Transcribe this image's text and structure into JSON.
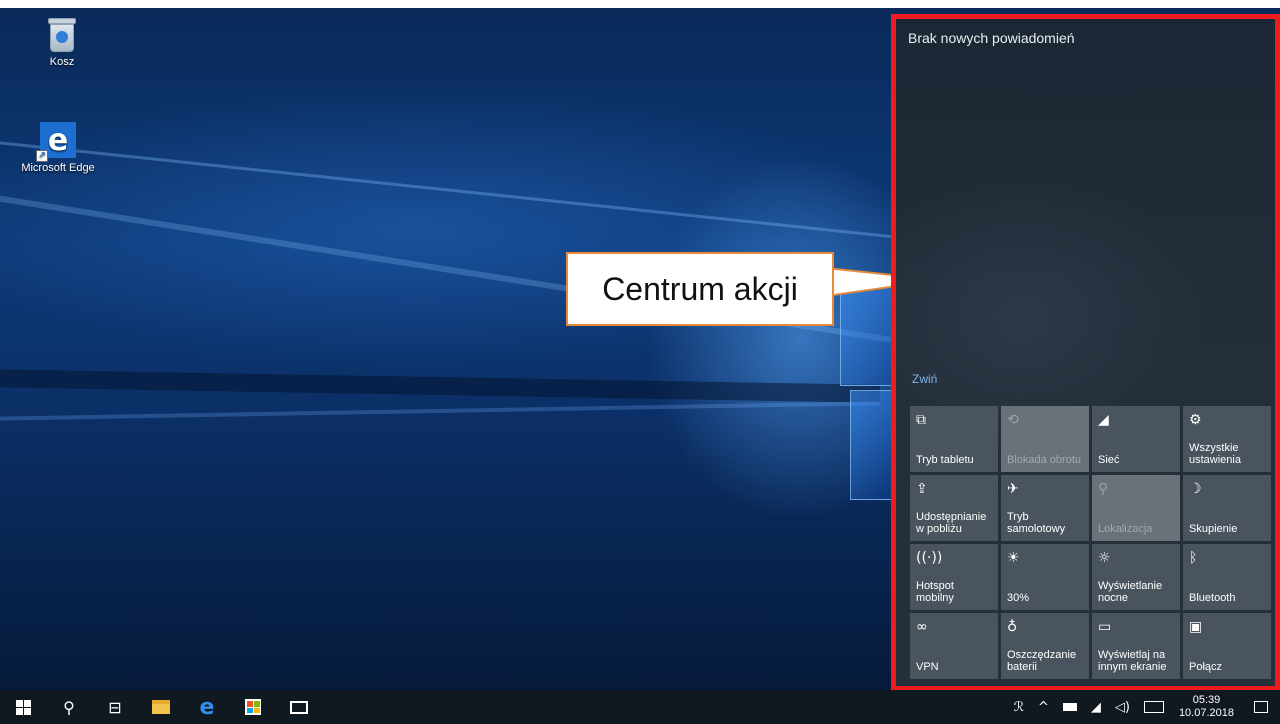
{
  "desktop": {
    "icons": [
      {
        "label": "Kosz",
        "icon": "recycle-bin-icon"
      },
      {
        "label": "Microsoft Edge",
        "icon": "edge-icon",
        "glyph": "e"
      }
    ]
  },
  "callout": {
    "text": "Centrum akcji"
  },
  "action_center": {
    "title": "Brak nowych powiadomień",
    "collapse_label": "Zwiń",
    "tiles": [
      {
        "label": "Tryb tabletu",
        "icon": "tablet-mode-icon",
        "glyph": "⧉",
        "active": true
      },
      {
        "label": "Blokada obrotu",
        "icon": "rotation-lock-icon",
        "glyph": "⟲",
        "active": false
      },
      {
        "label": "Sieć",
        "icon": "network-icon",
        "glyph": "◢",
        "active": true
      },
      {
        "label": "Wszystkie ustawienia",
        "icon": "gear-icon",
        "glyph": "⚙",
        "active": true
      },
      {
        "label": "Udostępnianie w pobliżu",
        "icon": "nearby-share-icon",
        "glyph": "⇪",
        "active": true
      },
      {
        "label": "Tryb samolotowy",
        "icon": "airplane-icon",
        "glyph": "✈",
        "active": true
      },
      {
        "label": "Lokalizacja",
        "icon": "location-icon",
        "glyph": "⚲",
        "active": false
      },
      {
        "label": "Skupienie",
        "icon": "moon-icon",
        "glyph": "☽",
        "active": true
      },
      {
        "label": "Hotspot mobilny",
        "icon": "hotspot-icon",
        "glyph": "((·))",
        "active": true
      },
      {
        "label": "30%",
        "icon": "brightness-icon",
        "glyph": "☀",
        "active": true
      },
      {
        "label": "Wyświetlanie nocne",
        "icon": "night-light-icon",
        "glyph": "☼",
        "active": true
      },
      {
        "label": "Bluetooth",
        "icon": "bluetooth-icon",
        "glyph": "ᛒ",
        "active": true
      },
      {
        "label": "VPN",
        "icon": "vpn-icon",
        "glyph": "∞",
        "active": true
      },
      {
        "label": "Oszczędzanie baterii",
        "icon": "battery-saver-icon",
        "glyph": "♁",
        "active": true
      },
      {
        "label": "Wyświetlaj na innym ekranie",
        "icon": "project-icon",
        "glyph": "▭",
        "active": true
      },
      {
        "label": "Połącz",
        "icon": "connect-icon",
        "glyph": "▣",
        "active": true
      }
    ]
  },
  "taskbar": {
    "items": [
      "start-icon",
      "search-icon",
      "task-view-icon",
      "file-explorer-icon",
      "edge-icon",
      "store-icon",
      "mail-icon"
    ],
    "search_glyph": "⚲",
    "taskview_glyph": "⊟",
    "edge_glyph": "e",
    "tray": {
      "people_glyph": "ℛ",
      "chevron_glyph": "^",
      "wifi_glyph": "◢",
      "volume_glyph": "◁)",
      "time": "05:39",
      "date": "10.07.2018"
    }
  },
  "colors": {
    "highlight_border": "#ee1c1c",
    "callout_border": "#e58a3a",
    "tile_active": "#4a545e",
    "tile_inactive": "#6b7179",
    "link": "#7fb6e6"
  }
}
